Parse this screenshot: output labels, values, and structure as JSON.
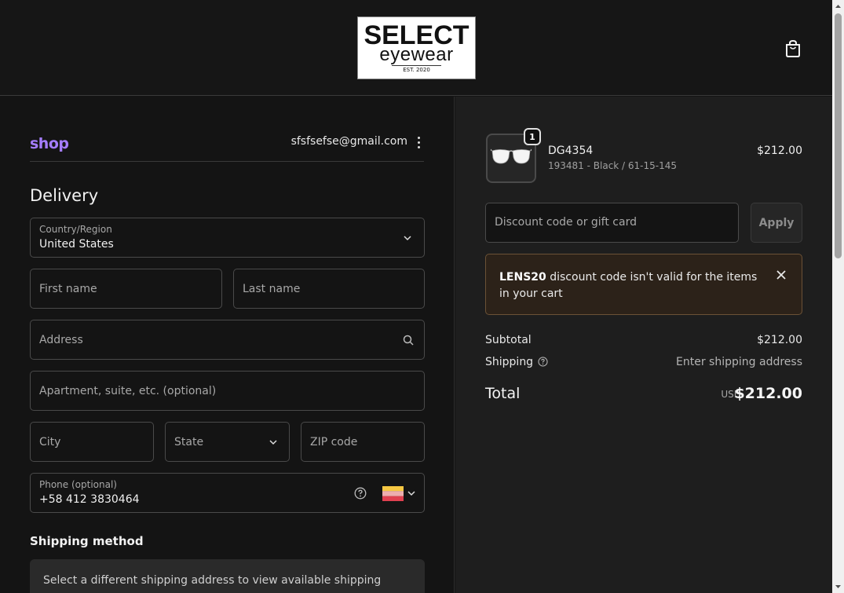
{
  "header": {
    "logo_line1": "SELECT",
    "logo_line2": "eyewear",
    "logo_line3": "EST. 2020",
    "cart_icon": "shopping-bag-icon"
  },
  "account": {
    "shop_label": "shop",
    "email": "sfsfsefse@gmail.com",
    "menu_icon": "kebab-menu-icon"
  },
  "delivery": {
    "heading": "Delivery",
    "country_label": "Country/Region",
    "country_value": "United States",
    "first_name_placeholder": "First name",
    "last_name_placeholder": "Last name",
    "address_placeholder": "Address",
    "apartment_placeholder": "Apartment, suite, etc. (optional)",
    "city_placeholder": "City",
    "state_placeholder": "State",
    "zip_placeholder": "ZIP code",
    "phone_label": "Phone (optional)",
    "phone_value": "+58 412 3830464",
    "phone_flag": "Venezuela flag"
  },
  "shipping_method": {
    "heading": "Shipping method",
    "message": "Select a different shipping address to view available shipping"
  },
  "cart": {
    "item": {
      "name": "DG4354",
      "variant": "193481 - Black / 61-15-145",
      "price": "$212.00",
      "quantity": "1"
    },
    "discount_placeholder": "Discount code or gift card",
    "apply_label": "Apply",
    "alert": {
      "code": "LENS20",
      "message": "discount code isn't valid for the items in your cart"
    },
    "subtotal_label": "Subtotal",
    "subtotal_value": "$212.00",
    "shipping_label": "Shipping",
    "shipping_value": "Enter shipping address",
    "total_label": "Total",
    "total_currency": "USD",
    "total_value": "$212.00"
  },
  "colors": {
    "shop_purple": "#a57dff",
    "alert_bg": "#2c2219",
    "alert_border": "#6b5236"
  }
}
